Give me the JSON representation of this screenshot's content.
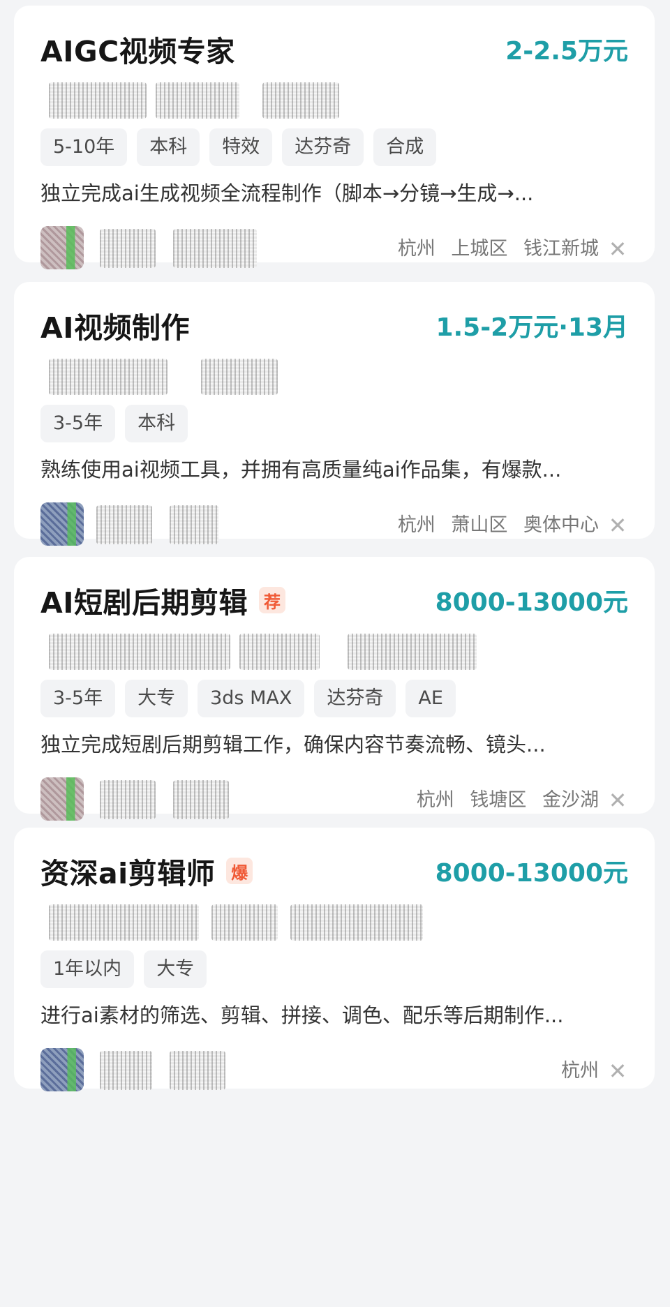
{
  "jobs": [
    {
      "title": "AIGC视频专家",
      "badge": "",
      "salary": "2-2.5万元",
      "tags": [
        "5-10年",
        "本科",
        "特效",
        "达芬奇",
        "合成"
      ],
      "description": "独立完成ai生成视频全流程制作（脚本→分镜→生成→...",
      "location": {
        "city": "杭州",
        "district": "上城区",
        "area": "钱江新城"
      }
    },
    {
      "title": "AI视频制作",
      "badge": "",
      "salary": "1.5-2万元·13月",
      "tags": [
        "3-5年",
        "本科"
      ],
      "description": "熟练使用ai视频工具，并拥有高质量纯ai作品集，有爆款...",
      "location": {
        "city": "杭州",
        "district": "萧山区",
        "area": "奥体中心"
      }
    },
    {
      "title": "AI短剧后期剪辑",
      "badge": "荐",
      "salary": "8000-13000元",
      "tags": [
        "3-5年",
        "大专",
        "3ds MAX",
        "达芬奇",
        "AE"
      ],
      "description": "独立完成短剧后期剪辑工作，确保内容节奏流畅、镜头...",
      "location": {
        "city": "杭州",
        "district": "钱塘区",
        "area": "金沙湖"
      }
    },
    {
      "title": "资深ai剪辑师",
      "badge": "爆",
      "salary": "8000-13000元",
      "tags": [
        "1年以内",
        "大专"
      ],
      "description": "进行ai素材的筛选、剪辑、拼接、调色、配乐等后期制作...",
      "location": {
        "city": "杭州",
        "district": "",
        "area": ""
      }
    }
  ],
  "icons": {
    "dismiss": "close-icon",
    "avatar": "recruiter-avatar"
  },
  "colors": {
    "salary": "#1e9ea7",
    "badge_bg": "#fde7df",
    "badge_text": "#f05a36"
  }
}
